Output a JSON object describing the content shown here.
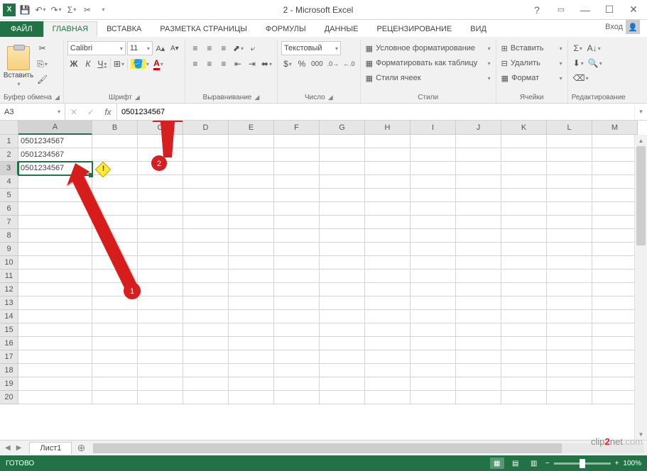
{
  "title": "2 - Microsoft Excel",
  "tabs": {
    "file": "ФАЙЛ",
    "home": "ГЛАВНАЯ",
    "insert": "ВСТАВКА",
    "layout": "РАЗМЕТКА СТРАНИЦЫ",
    "formulas": "ФОРМУЛЫ",
    "data": "ДАННЫЕ",
    "review": "РЕЦЕНЗИРОВАНИЕ",
    "view": "ВИД",
    "login": "Вход"
  },
  "ribbon": {
    "clipboard": {
      "paste": "Вставить",
      "label": "Буфер обмена"
    },
    "font": {
      "name": "Calibri",
      "size": "11",
      "bold": "Ж",
      "italic": "К",
      "underline": "Ч",
      "label": "Шрифт"
    },
    "alignment": {
      "label": "Выравнивание"
    },
    "number": {
      "format": "Текстовый",
      "label": "Число"
    },
    "styles": {
      "cond": "Условное форматирование",
      "table": "Форматировать как таблицу",
      "cell": "Стили ячеек",
      "label": "Стили"
    },
    "cells": {
      "insert": "Вставить",
      "delete": "Удалить",
      "format": "Формат",
      "label": "Ячейки"
    },
    "editing": {
      "label": "Редактирование"
    }
  },
  "namebox": "A3",
  "formula": "0501234567",
  "columns": [
    "A",
    "B",
    "C",
    "D",
    "E",
    "F",
    "G",
    "H",
    "I",
    "J",
    "K",
    "L",
    "M"
  ],
  "rows": [
    "1",
    "2",
    "3",
    "4",
    "5",
    "6",
    "7",
    "8",
    "9",
    "10",
    "11",
    "12",
    "13",
    "14",
    "15",
    "16",
    "17",
    "18",
    "19",
    "20"
  ],
  "cells": {
    "A1": "0501234567",
    "A2": "0501234567",
    "A3": "0501234567"
  },
  "selected": {
    "col": "A",
    "row": "3"
  },
  "annotations": {
    "callout1": "1",
    "callout2": "2"
  },
  "sheet": "Лист1",
  "status": "ГОТОВО",
  "zoom": "100%",
  "watermark_parts": [
    "clip",
    "2",
    "net",
    ".com"
  ]
}
